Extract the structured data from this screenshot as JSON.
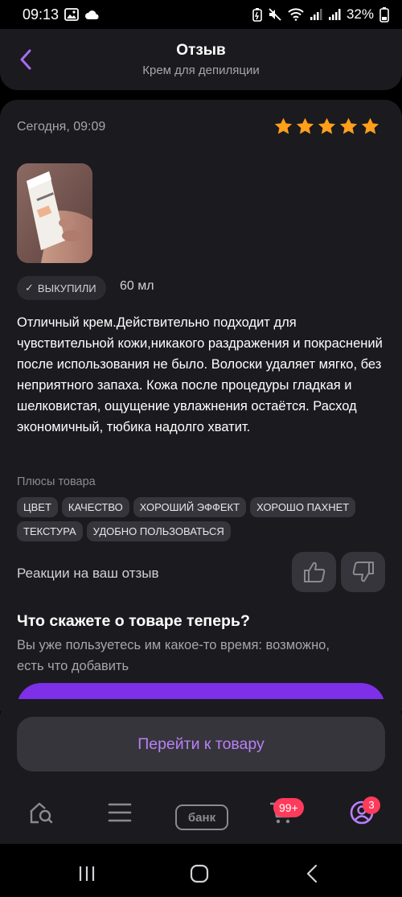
{
  "status_bar": {
    "time": "09:13",
    "battery": "32%",
    "icons": [
      "gallery-icon",
      "weather-icon",
      "battery-saver-icon",
      "mute-icon",
      "wifi-icon",
      "signal-icon",
      "signal-icon"
    ]
  },
  "header": {
    "title": "Отзыв",
    "subtitle": "Крем для депиляции"
  },
  "review": {
    "date": "Сегодня, 09:09",
    "rating": 5,
    "rating_color": "#ff9f1a",
    "badge": "ВЫКУПИЛИ",
    "volume": "60 мл",
    "text": "Отличный крем.Действительно подходит для чувствительной кожи,никакого раздражения и покраснений после использования не было. Волоски удаляет мягко, без неприятного запаха. Кожа после процедуры гладкая и шелковистая, ощущение увлажнения остаётся. Расход экономичный, тюбика надолго хватит.",
    "pros_label": "Плюсы товара",
    "pros": [
      "ЦВЕТ",
      "КАЧЕСТВО",
      "ХОРОШИЙ ЭФФЕКТ",
      "ХОРОШО ПАХНЕТ",
      "ТЕКСТУРА",
      "УДОБНО ПОЛЬЗОВАТЬСЯ"
    ],
    "reactions_label": "Реакции на ваш отзыв"
  },
  "cta": {
    "title": "Что скажете о товаре теперь?",
    "text": "Вы уже пользуетесь им какое-то время: возможно, есть что добавить",
    "accent": "#7e2fe8"
  },
  "goto_button": "Перейти к товару",
  "tabbar": {
    "bank_label": "банк",
    "cart_badge": "99+",
    "profile_badge": "3"
  }
}
